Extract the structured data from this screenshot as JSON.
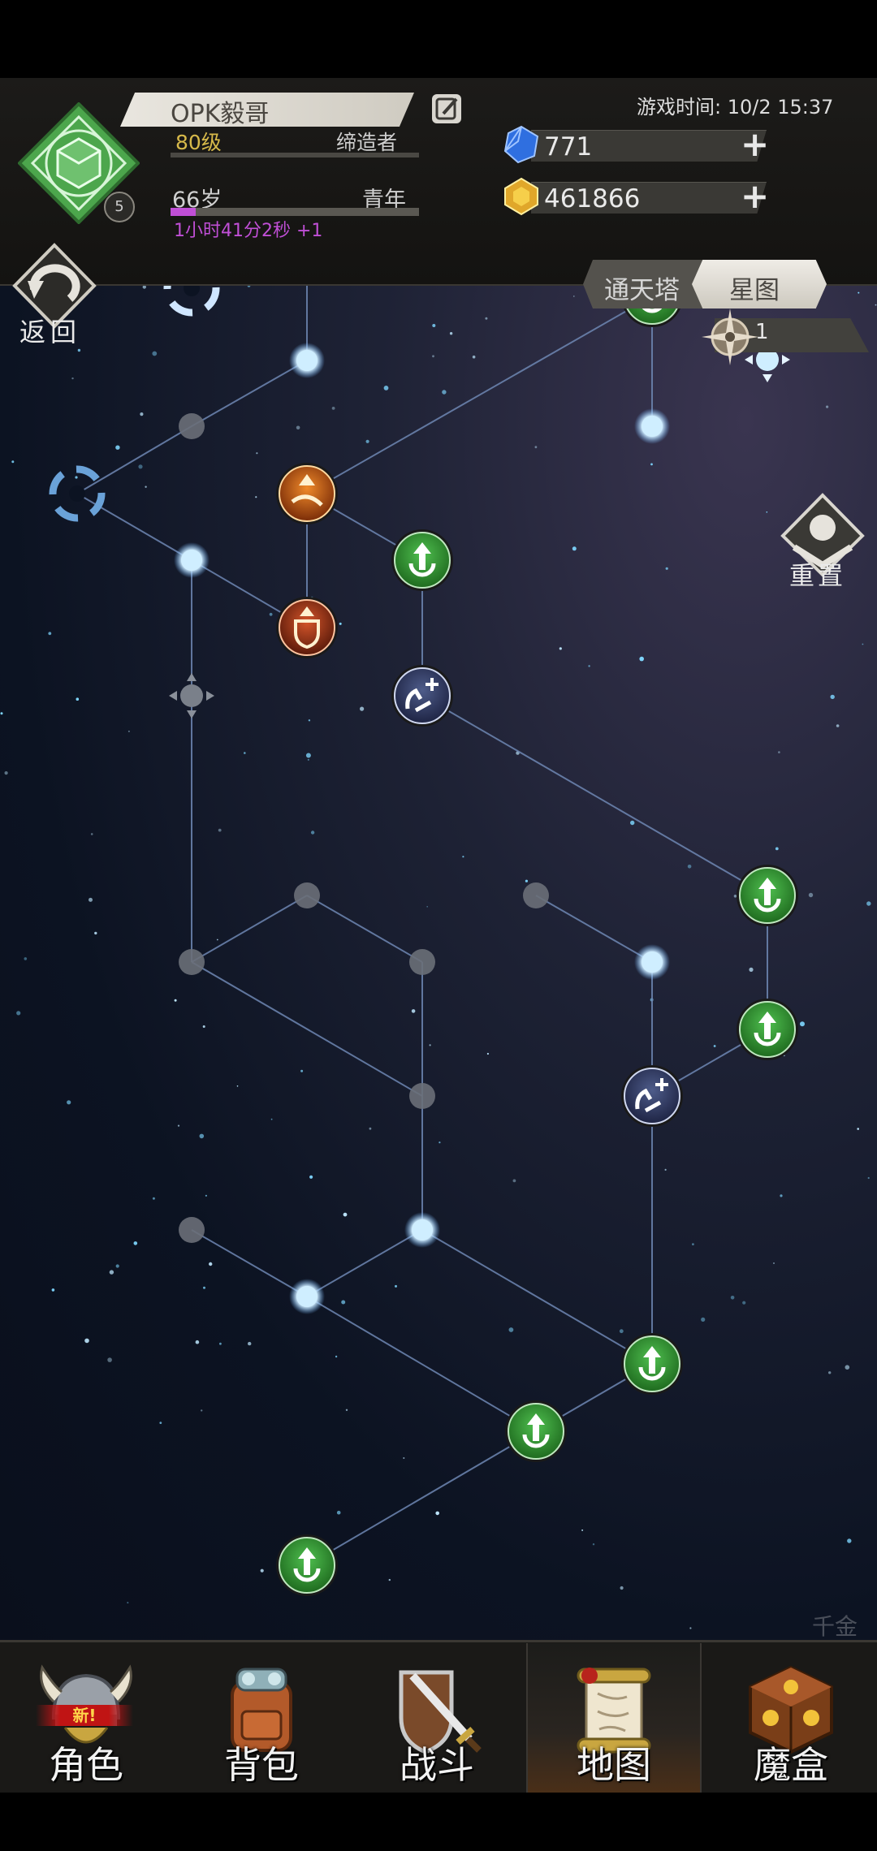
{
  "player": {
    "name": "OPK毅哥",
    "level": "80级",
    "title": "缔造者",
    "age": "66岁",
    "age_stage": "青年",
    "age_progress": 0.1,
    "timer": "1小时41分2秒 +1",
    "avatar_badge": "5"
  },
  "game_time": "游戏时间: 10/2 15:37",
  "resources": {
    "gems": "771",
    "gold": "461866"
  },
  "back_label": "返回",
  "tabs": {
    "tower": "通天塔",
    "star_map": "星图"
  },
  "star_counter": "1",
  "reset_label": "重置",
  "watermark": "千金",
  "nav": [
    {
      "label": "角色",
      "badge": "新!"
    },
    {
      "label": "背包"
    },
    {
      "label": "战斗"
    },
    {
      "label": "地图"
    },
    {
      "label": "魔盒"
    }
  ],
  "colors": {
    "green_node": "#2f8a2f",
    "active_node": "#cfeeff",
    "inactive_node": "#6a6f78",
    "line": "#6e87b3",
    "accent_purple": "#c04fd6"
  }
}
